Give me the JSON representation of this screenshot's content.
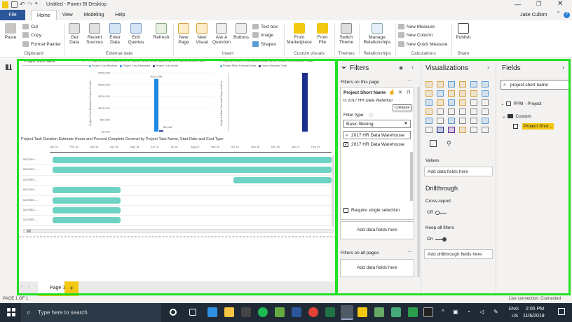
{
  "window": {
    "title": "Untitled - Power BI Desktop",
    "user": "Jake Cullom"
  },
  "tabs": [
    {
      "label": "File"
    },
    {
      "label": "Home"
    },
    {
      "label": "View"
    },
    {
      "label": "Modeling"
    },
    {
      "label": "Help"
    }
  ],
  "ribbon": {
    "clipboard": {
      "paste": "Paste",
      "cut": "Cut",
      "copy": "Copy",
      "format_painter": "Format Painter",
      "group": "Clipboard"
    },
    "external_data": {
      "get_data": "Get Data",
      "recent_sources": "Recent Sources",
      "enter_data": "Enter Data",
      "edit_queries": "Edit Queries",
      "refresh": "Refresh",
      "group": "External data"
    },
    "insert": {
      "new_page": "New Page",
      "new_visual": "New Visual",
      "ask_question": "Ask A Question",
      "buttons": "Buttons",
      "text_box": "Text box",
      "image": "Image",
      "shapes": "Shapes",
      "group": "Insert"
    },
    "custom_visuals": {
      "from_marketplace": "From Marketplace",
      "from_file": "From File",
      "group": "Custom visuals"
    },
    "themes": {
      "switch_theme": "Switch Theme",
      "group": "Themes"
    },
    "relationships": {
      "manage": "Manage Relationships",
      "group": "Relationships"
    },
    "calculations": {
      "new_measure": "New Measure",
      "new_column": "New Column",
      "new_quick_measure": "New Quick Measure",
      "group": "Calculations"
    },
    "share": {
      "publish": "Publish",
      "group": "Share"
    }
  },
  "canvas": {
    "slicer_header": "Project Short Name",
    "chart1": {
      "title": "Project Cost Baseline, Project Cost Estimated and Project Cost Act...",
      "legend": [
        "Project Cost Baseline",
        "Project Cost Estimated",
        "Project Cost Actual"
      ],
      "ylabel": "Project Cost Baseline Project Cost E..."
    },
    "chart2": {
      "title": "Project Effort Forecast Days and Hours Allocated Total",
      "legend": [
        "Project Effort Forecast Days",
        "Hours Allocated Total"
      ],
      "ylabel": "Project Effort Forecast Days and Ho..."
    },
    "gantt": {
      "title": "Project Task Duration Estimate Hours and Percent Complete Decimal by Project Task Name, Start Date and Cost Type",
      "months": [
        "Jan 18",
        "Feb 18",
        "Mar 18",
        "Apr 18",
        "May 18",
        "Jun 18",
        "Jul 18",
        "Aug 18",
        "Sep 18",
        "Oct 18",
        "Nov 18",
        "Dec 18",
        "Jan 19",
        "Feb 19"
      ],
      "rows": [
        "5127044 -...",
        "5127092 -...",
        "5127093 -...",
        "5127048 -...",
        "5127050 -...",
        "5127054 -...",
        "5127055 -..."
      ]
    },
    "page_tab": "Page 1",
    "add_page": "+"
  },
  "chart_data": [
    {
      "type": "bar",
      "title": "Project Cost Baseline, Project Cost Estimated and Project Cost Act...",
      "ylabel": "Project Cost Baseline Project Cost E...",
      "yticks": [
        "$250,000",
        "$200,000",
        "$150,000",
        "$100,000",
        "$50,000",
        "$0,000"
      ],
      "ylim": [
        0,
        250000
      ],
      "series": [
        {
          "name": "Project Cost Baseline",
          "values": [
            0
          ]
        },
        {
          "name": "Project Cost Estimated",
          "values": [
            223998
          ]
        },
        {
          "name": "Project Cost Actual",
          "values": [
            5448
          ]
        }
      ],
      "data_labels": [
        "$223,998",
        "$5,448"
      ],
      "colors": [
        "#46b0d9",
        "#1e88e5",
        "#1b2f8c"
      ]
    },
    {
      "type": "bar",
      "title": "Project Effort Forecast Days and Hours Allocated Total",
      "ylabel": "Project Effort Forecast Days and Ho...",
      "series": [
        {
          "name": "Project Effort Forecast Days",
          "values": [
            0
          ]
        },
        {
          "name": "Hours Allocated Total",
          "values": [
            1
          ]
        }
      ],
      "colors": [
        "#46b0d9",
        "#1b2f8c"
      ]
    },
    {
      "type": "bar",
      "title": "Project Task Duration Estimate Hours and Percent Complete Decimal by Project Task Name, Start Date and Cost Type",
      "x": [
        "Jan 18",
        "Feb 18",
        "Mar 18",
        "Apr 18",
        "May 18",
        "Jun 18",
        "Jul 18",
        "Aug 18",
        "Sep 18",
        "Oct 18",
        "Nov 18",
        "Dec 18",
        "Jan 19",
        "Feb 19"
      ],
      "categories": [
        "5127044 -...",
        "5127092 -...",
        "5127093 -...",
        "5127048 -...",
        "5127050 -...",
        "5127054 -...",
        "5127055 -..."
      ],
      "series": [
        {
          "values": [
            [
              0,
              14
            ],
            [
              0,
              14
            ],
            [
              9,
              14
            ],
            [
              0,
              3.5
            ],
            [
              0,
              3.5
            ],
            [
              0,
              3.5
            ],
            [
              0,
              3.5
            ]
          ]
        }
      ],
      "color": "#6fd3c3"
    }
  ],
  "filters": {
    "title": "Filters",
    "on_this_page": "Filters on this page",
    "card_title": "Project Short Name",
    "card_value": "is 2017 HR Data Warehouse",
    "tooltip": "Collapse",
    "filter_type_label": "Filter type",
    "filter_type_value": "Basic filtering",
    "search_value": "2017 HR Data Warehouse",
    "option": "2017 HR Data Warehouse",
    "option_checked": true,
    "require_single": "Require single selection",
    "add_fields": "Add data fields here",
    "on_all_pages": "Filters on all pages",
    "add_fields_all": "Add data fields here"
  },
  "visualizations": {
    "title": "Visualizations",
    "values_label": "Values",
    "add_fields": "Add data fields here",
    "drillthrough": "Drillthrough",
    "cross_report": "Cross-report",
    "cross_report_state": "Off",
    "keep_filters": "Keep all filters",
    "keep_filters_state": "On",
    "add_drillthrough": "Add drillthrough fields here"
  },
  "fields": {
    "title": "Fields",
    "search_value": "project short name",
    "table": "PPM - Project",
    "folder": "Custom",
    "field": "Project Shor..."
  },
  "status": {
    "page": "PAGE 1 OF 1",
    "connection": "Live connection: Connected"
  },
  "taskbar": {
    "search_placeholder": "Type here to search",
    "time": "2:05 PM",
    "date": "11/6/2019",
    "lang": "ENG",
    "region": "US"
  },
  "colors": {
    "file_tab": "#2b579a",
    "highlight": "#22e022",
    "taskbar": "#1f2a36"
  }
}
